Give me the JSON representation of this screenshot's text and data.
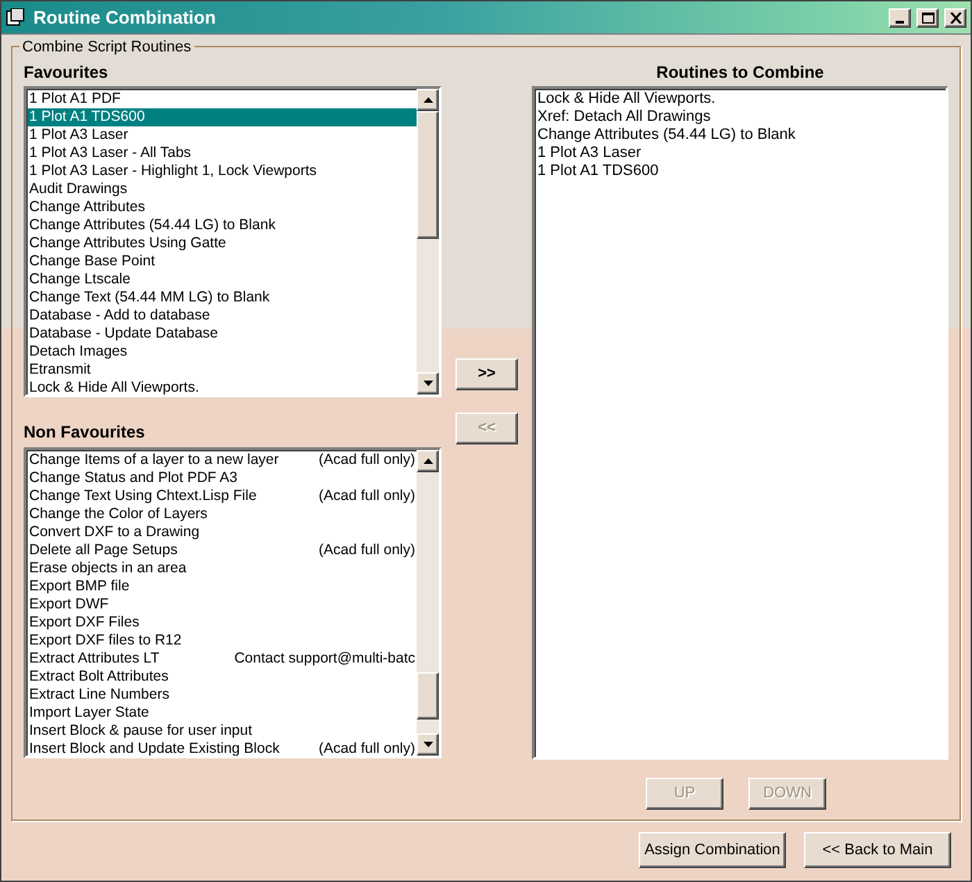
{
  "window": {
    "title": "Routine Combination"
  },
  "group": {
    "title": "Combine Script Routines"
  },
  "favourites": {
    "label": "Favourites",
    "items": [
      {
        "label": "1 Plot A1 PDF",
        "selected": false
      },
      {
        "label": "1 Plot A1 TDS600",
        "selected": true
      },
      {
        "label": "1 Plot A3 Laser",
        "selected": false
      },
      {
        "label": "1 Plot A3 Laser - All Tabs",
        "selected": false
      },
      {
        "label": "1 Plot A3 Laser - Highlight 1, Lock Viewports",
        "selected": false
      },
      {
        "label": "Audit Drawings",
        "selected": false
      },
      {
        "label": "Change Attributes",
        "selected": false
      },
      {
        "label": "Change Attributes (54.44 LG) to Blank",
        "selected": false
      },
      {
        "label": "Change Attributes Using Gatte",
        "selected": false
      },
      {
        "label": "Change Base Point",
        "selected": false
      },
      {
        "label": "Change Ltscale",
        "selected": false
      },
      {
        "label": "Change Text (54.44 MM LG) to Blank",
        "selected": false
      },
      {
        "label": "Database - Add to database",
        "selected": false
      },
      {
        "label": "Database - Update Database",
        "selected": false
      },
      {
        "label": "Detach Images",
        "selected": false
      },
      {
        "label": "Etransmit",
        "selected": false
      },
      {
        "label": "Lock & Hide All Viewports.",
        "selected": false
      }
    ]
  },
  "non_favourites": {
    "label": "Non Favourites",
    "items": [
      {
        "label": "Change Items of a layer to a new layer",
        "note": "(Acad full only)",
        "selected": false
      },
      {
        "label": "Change Status and Plot PDF A3",
        "selected": false
      },
      {
        "label": "Change Text Using Chtext.Lisp File",
        "note": "(Acad full only)",
        "selected": false
      },
      {
        "label": "Change the Color of Layers",
        "selected": false
      },
      {
        "label": "Convert DXF to a Drawing",
        "selected": false
      },
      {
        "label": "Delete all Page Setups",
        "note": "(Acad full only)",
        "selected": false
      },
      {
        "label": "Erase objects in an area",
        "selected": false
      },
      {
        "label": "Export BMP file",
        "selected": false
      },
      {
        "label": "Export DWF",
        "selected": false
      },
      {
        "label": "Export DXF Files",
        "selected": false
      },
      {
        "label": "Export DXF files to R12",
        "selected": false
      },
      {
        "label": "Extract Attributes LT",
        "note": "Contact support@multi-batc",
        "selected": false
      },
      {
        "label": "Extract Bolt Attributes",
        "selected": false
      },
      {
        "label": "Extract Line Numbers",
        "selected": false
      },
      {
        "label": "Import Layer State",
        "selected": false
      },
      {
        "label": "Insert Block & pause for user input",
        "selected": false
      },
      {
        "label": "Insert Block and Update Existing Block",
        "note": "(Acad full only)",
        "selected": false
      }
    ]
  },
  "move_buttons": [
    {
      "label": ">>",
      "disabled": false
    },
    {
      "label": "<<",
      "disabled": true
    }
  ],
  "routines_to_combine": {
    "label": "Routines to Combine",
    "items": [
      "Lock & Hide All Viewports.",
      "Xref: Detach All Drawings",
      "Change Attributes (54.44 LG) to Blank",
      "1 Plot A3 Laser",
      "1 Plot A1 TDS600"
    ]
  },
  "order_buttons": [
    {
      "label": "UP",
      "disabled": true
    },
    {
      "label": "DOWN",
      "disabled": true
    }
  ],
  "buttons": [
    {
      "label": "Assign Combination"
    },
    {
      "label": "<< Back to Main"
    }
  ]
}
